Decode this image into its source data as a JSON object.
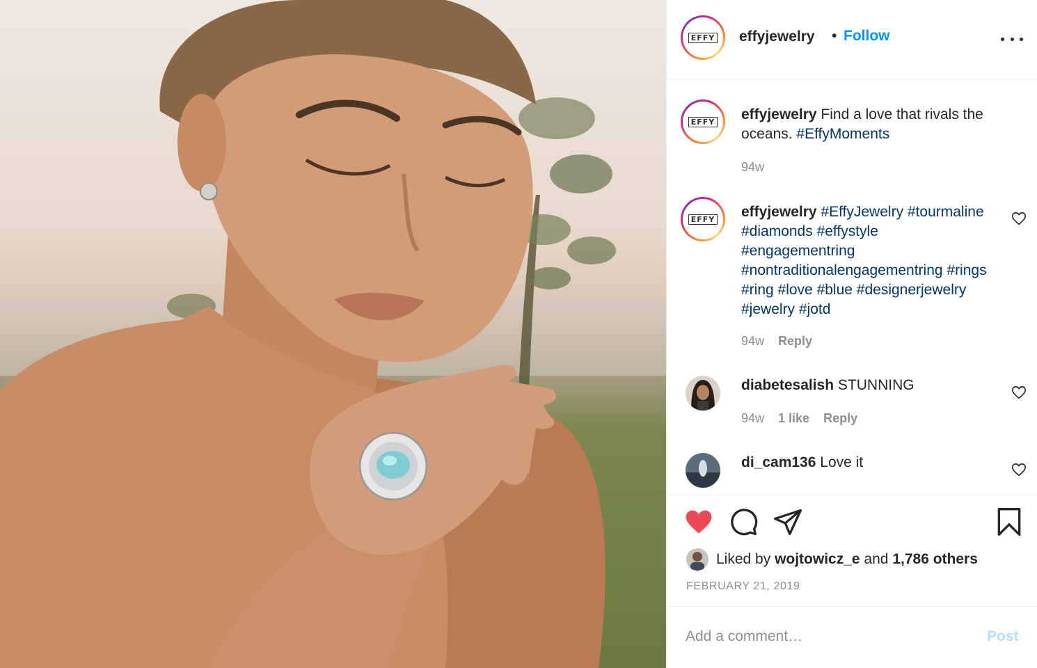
{
  "post": {
    "image_alt": "Woman wearing an oval blue tourmaline halo ring and stud earring",
    "account": {
      "username": "effyjewelry",
      "separator": "•",
      "follow_label": "Follow",
      "logo_text": "EFFY"
    },
    "comments": [
      {
        "username": "effyjewelry",
        "text": "Find a love that rivals the oceans.",
        "hashtags": "#EffyMoments",
        "age": "94w"
      },
      {
        "username": "effyjewelry",
        "hashtags": "#EffyJewelry #tourmaline #diamonds #effystyle #engagementring #nontraditionalengagementring #rings #ring #love #blue #designerjewelry #jewelry #jotd",
        "age": "94w",
        "reply_label": "Reply"
      },
      {
        "username": "diabetesalish",
        "text": "STUNNING",
        "age": "94w",
        "likes": "1 like",
        "reply_label": "Reply"
      },
      {
        "username": "di_cam136",
        "text": "Love it"
      }
    ],
    "likes": {
      "prefix": "Liked by",
      "user": "wojtowicz_e",
      "joiner": "and",
      "others": "1,786 others"
    },
    "date": "FEBRUARY 21, 2019",
    "add_comment": {
      "placeholder": "Add a comment…",
      "post_label": "Post"
    },
    "colors": {
      "link": "#0095f6",
      "hashtag": "#00376b",
      "liked_heart": "#ed4956",
      "muted": "#8e8e8e",
      "post_disabled": "#b2dffc"
    },
    "icons": [
      "heart-filled-icon",
      "comment-icon",
      "share-icon",
      "bookmark-icon",
      "more-icon",
      "heart-outline-icon"
    ]
  }
}
